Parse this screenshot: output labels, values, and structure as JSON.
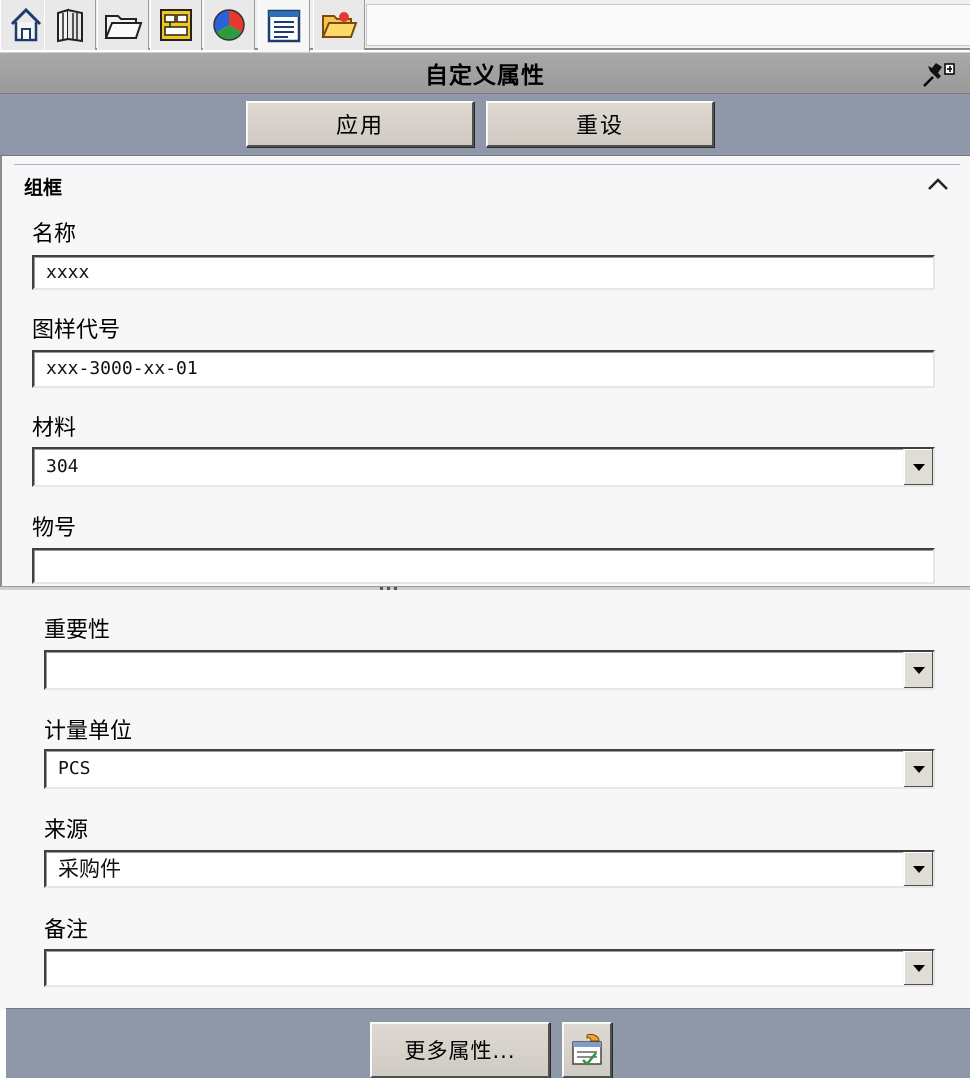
{
  "tabs": [
    {
      "name": "featuremanager-tab",
      "icon": "home-icon"
    },
    {
      "name": "property-manager-tab",
      "icon": "books-icon"
    },
    {
      "name": "configuration-manager-tab",
      "icon": "folder-icon"
    },
    {
      "name": "dimxpert-tab",
      "icon": "dimension-icon"
    },
    {
      "name": "display-manager-tab",
      "icon": "color-wheel-icon"
    },
    {
      "name": "custom-properties-tab",
      "icon": "property-list-icon"
    },
    {
      "name": "open-folder-tab",
      "icon": "open-folder-icon"
    }
  ],
  "panel": {
    "title": "自定义属性",
    "pin_icon": "pushpin-icon"
  },
  "actions": {
    "apply_label": "应用",
    "reset_label": "重设"
  },
  "group": {
    "title": "组框",
    "collapse_icon": "chevron-up-icon"
  },
  "fields": {
    "name": {
      "label": "名称",
      "value": "xxxx"
    },
    "drawing_no": {
      "label": "图样代号",
      "value": "xxx-3000-xx-01"
    },
    "material": {
      "label": "材料",
      "value": "304"
    },
    "item_no": {
      "label": "物号",
      "value": ""
    },
    "importance": {
      "label": "重要性",
      "value": ""
    },
    "unit": {
      "label": "计量单位",
      "value": "PCS"
    },
    "source": {
      "label": "来源",
      "value": "采购件"
    },
    "remark": {
      "label": "备注",
      "value": ""
    }
  },
  "footer": {
    "more_label": "更多属性...",
    "icon": "property-tab-builder-icon"
  }
}
